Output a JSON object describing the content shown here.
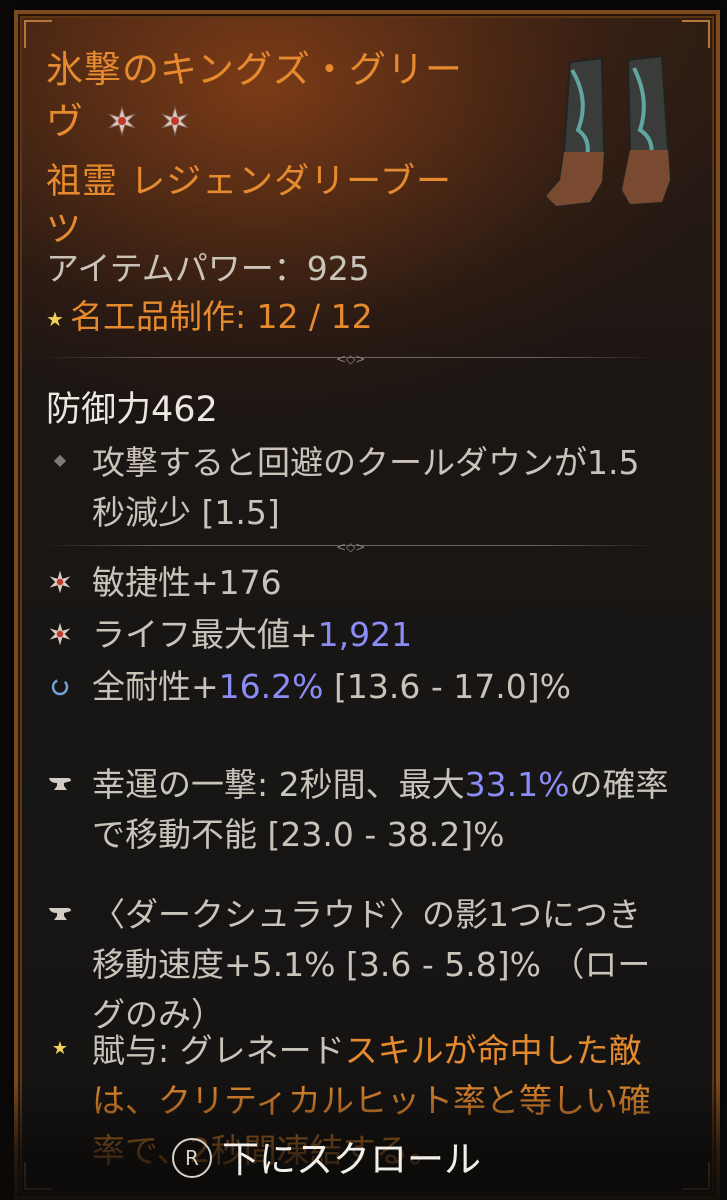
{
  "item": {
    "title": "氷撃のキングズ・グリーヴ",
    "subtitle": "祖霊 レジェンダリーブーツ",
    "item_power": "アイテムパワー：925",
    "masterwork": "名工品制作: 12 / 12"
  },
  "defense": "防御力462",
  "implicit": "攻撃すると回避のクールダウンが1.5秒減少 [1.5]",
  "affixes": [
    {
      "icon": "greater-affix-icon",
      "text": "敏捷性+176"
    },
    {
      "icon": "greater-affix-icon",
      "pre": "ライフ最大値+",
      "value": "1,921"
    },
    {
      "icon": "tempered-affix-icon",
      "pre": "全耐性+",
      "value": "16.2%",
      "post": " [13.6 - 17.0]%"
    },
    {
      "icon": "anvil-icon",
      "pre": "幸運の一撃: 2秒間、最大",
      "value": "33.1%",
      "post": "の確率で移動不能 [23.0 - 38.2]%"
    },
    {
      "icon": "anvil-icon",
      "text": "〈ダークシュラウド〉の影1つにつき移動速度+5.1% [3.6 - 5.8]% （ローグのみ）"
    },
    {
      "icon": "legendary-star-icon",
      "pre": "賦与: グレネード",
      "orange": "スキルが命中した敵は、クリティカルヒット率と等しい確率で、2秒間凍結する。"
    }
  ],
  "scroll_hint": {
    "button": "R",
    "label": "下にスクロール"
  },
  "colors": {
    "legendary": "#e58a2e",
    "value": "#8b8cf5",
    "text": "#c9c3ba"
  }
}
